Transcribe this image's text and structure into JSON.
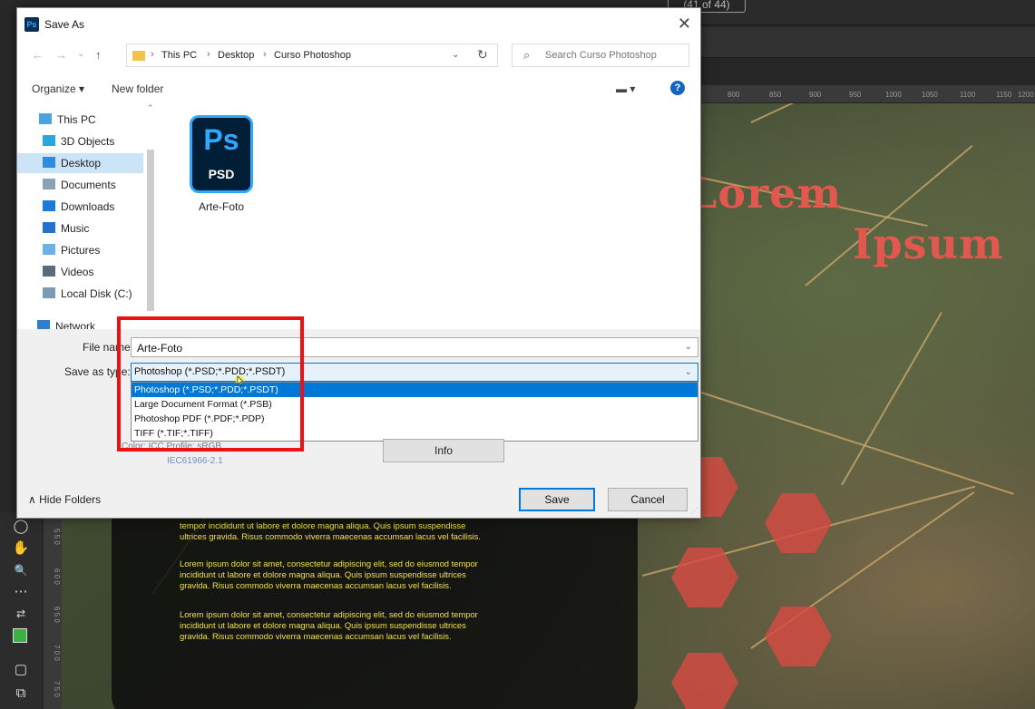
{
  "dialog": {
    "title": "Save As",
    "app_icon": "Ps",
    "close_icon": "✕"
  },
  "nav": {
    "back": "←",
    "forward": "→",
    "down": "⌄",
    "up": "↑"
  },
  "address": {
    "crumbs": [
      "This PC",
      "Desktop",
      "Curso Photoshop"
    ],
    "separator": "›",
    "dropdown": "⌄",
    "refresh": "↻"
  },
  "search": {
    "placeholder": "Search Curso Photoshop"
  },
  "toolbar": {
    "organize": "Organize ▾",
    "new_folder": "New folder",
    "view": "▬ ▾",
    "help": "?"
  },
  "sidebar": {
    "items": [
      {
        "label": "This PC",
        "icon": "computer-icon",
        "color": "#4aa3df"
      },
      {
        "label": "3D Objects",
        "icon": "cube-icon",
        "color": "#29a8e0"
      },
      {
        "label": "Desktop",
        "icon": "desktop-icon",
        "color": "#2d8ce0"
      },
      {
        "label": "Documents",
        "icon": "documents-icon",
        "color": "#8aa2b8"
      },
      {
        "label": "Downloads",
        "icon": "download-icon",
        "color": "#1e7ad6"
      },
      {
        "label": "Music",
        "icon": "music-icon",
        "color": "#2573c9"
      },
      {
        "label": "Pictures",
        "icon": "pictures-icon",
        "color": "#6cb0e8"
      },
      {
        "label": "Videos",
        "icon": "videos-icon",
        "color": "#5a6b7d"
      },
      {
        "label": "Local Disk (C:)",
        "icon": "disk-icon",
        "color": "#7a9ab5"
      },
      {
        "label": "Network",
        "icon": "network-icon",
        "color": "#2d7fd0"
      }
    ],
    "selected": "Desktop"
  },
  "files": [
    {
      "name": "Arte-Foto",
      "icon_main": "Ps",
      "icon_sub": "PSD"
    }
  ],
  "form": {
    "file_name_label": "File name:",
    "file_name_value": "Arte-Foto",
    "save_type_label": "Save as type:",
    "save_type_value": "Photoshop (*.PSD;*.PDD;*.PSDT)",
    "type_options": [
      "Photoshop (*.PSD;*.PDD;*.PSDT)",
      "Large Document Format (*.PSB)",
      "Photoshop PDF (*.PDF;*.PDP)",
      "TIFF (*.TIF;*.TIFF)"
    ],
    "selected_option_index": 0,
    "color_hint": "Color: ICC Profile: sRGB",
    "icc_hint": "IEC61966-2.1",
    "chevron": "⌄"
  },
  "buttons": {
    "info": "Info",
    "hide_folders": "∧  Hide Folders",
    "save": "Save",
    "cancel": "Cancel"
  },
  "photoshop": {
    "doc_counter": "(41 of 44)",
    "ruler_top": [
      "800",
      "850",
      "900",
      "950",
      "1000",
      "1050",
      "1100",
      "1150",
      "1200",
      "125"
    ],
    "ruler_left": [
      "5 5 0",
      "6 0 0",
      "6 5 0",
      "7 0 0",
      "7 5 0"
    ],
    "canvas_title_1": "Lorem",
    "canvas_title_2": "Ipsum",
    "canvas_lines": [
      "tempor incididunt ut labore et dolore magna aliqua. Quis ipsum suspendisse",
      "ultrices gravida. Risus commodo viverra maecenas accumsan lacus vel facilisis.",
      "Lorem ipsum dolor sit amet, consectetur adipiscing elit, sed do eiusmod tempor",
      "incididunt ut labore et dolore magna aliqua. Quis ipsum suspendisse ultrices",
      "gravida. Risus commodo viverra maecenas accumsan lacus vel facilisis.",
      "Lorem ipsum dolor sit amet, consectetur adipiscing elit, sed do eiusmod tempor",
      "incididunt ut labore et dolore magna aliqua. Quis ipsum suspendisse ultrices",
      "gravida. Risus commodo viverra maecenas accumsan lacus vel facilisis."
    ],
    "tools": [
      "◯",
      "✋",
      "🔍",
      "⋯",
      "⇄",
      "▢",
      "⧉"
    ],
    "accent": "#31a8ff",
    "title_color": "#e2574e",
    "text_color": "#f0e040"
  },
  "colors": {
    "highlight": "#ee1111",
    "selection": "#0078d7",
    "nav_selected": "#cce4f7"
  }
}
